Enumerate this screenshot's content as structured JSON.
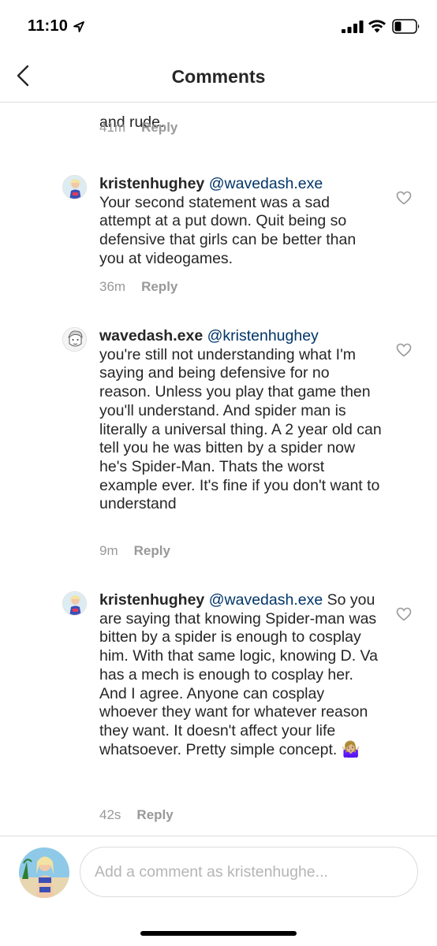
{
  "status_bar": {
    "time": "11:10"
  },
  "nav": {
    "title": "Comments"
  },
  "comments": [
    {
      "user": "",
      "mention": "",
      "text": "and rude.",
      "age": "41m",
      "reply": "Reply"
    },
    {
      "user": "kristenhughey",
      "mention": "@wavedash.exe",
      "text": "Your second statement was a sad attempt at a put down.  Quit being so defensive that girls can be better than you at videogames.",
      "age": "36m",
      "reply": "Reply"
    },
    {
      "user": "wavedash.exe",
      "mention": "@kristenhughey",
      "text": "you're still not understanding what I'm saying and being defensive for no reason. Unless you play that game then you'll understand. And spider man is literally a universal thing. A 2 year old can tell you he was bitten by a spider now he's Spider-Man. Thats the worst example ever. It's fine if you don't want to understand",
      "age": "9m",
      "reply": "Reply"
    },
    {
      "user": "kristenhughey",
      "mention": "@wavedash.exe",
      "text": "So you are saying that knowing Spider-man was bitten by a spider is enough to cosplay him.  With that same logic, knowing D. Va has a mech is enough to cosplay her.  And I agree.  Anyone can cosplay whoever they want for whatever reason they want.  It doesn't affect your life whatsoever.  Pretty simple concept. 🤷🏼‍♀️",
      "age": "42s",
      "reply": "Reply"
    }
  ],
  "composer": {
    "placeholder": "Add a comment as kristenhughe..."
  },
  "colors": {
    "mention": "#003569",
    "meta": "#999999",
    "divider": "#dbdbdb"
  }
}
